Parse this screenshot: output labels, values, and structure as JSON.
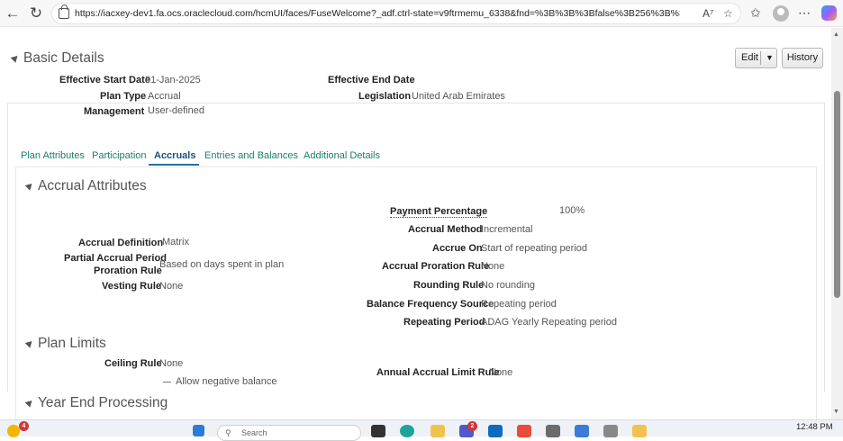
{
  "browser": {
    "url": "https://iacxey-dev1.fa.ocs.oraclecloud.com/hcmUI/faces/FuseWelcome?_adf.ctrl-state=v9ftrmemu_6338&fnd=%3B%3B%3Bfalse%3B256%3B%3B%..."
  },
  "basic_details": {
    "title": "Basic Details",
    "edit_label": "Edit",
    "history_label": "History",
    "fields": {
      "effective_start_label": "Effective Start Date",
      "effective_start_value": "01-Jan-2025",
      "effective_end_label": "Effective End Date",
      "effective_end_value": "",
      "plan_type_label": "Plan Type",
      "plan_type_value": "Accrual",
      "legislation_label": "Legislation",
      "legislation_value": "United Arab Emirates",
      "management_label": "Management",
      "management_value": "User-defined"
    }
  },
  "tabs": [
    "Plan Attributes",
    "Participation",
    "Accruals",
    "Entries and Balances",
    "Additional Details"
  ],
  "accrual_attributes": {
    "title": "Accrual Attributes",
    "payment_percentage_label": "Payment Percentage",
    "payment_percentage_value": "100%",
    "accrual_method_label": "Accrual Method",
    "accrual_method_value": "Incremental",
    "accrual_definition_label": "Accrual Definition",
    "accrual_definition_value": "Matrix",
    "accrue_on_label": "Accrue On",
    "accrue_on_value": "Start of repeating period",
    "partial_period_label_1": "Partial Accrual Period",
    "partial_period_label_2": "Proration Rule",
    "partial_period_value": "Based on days spent in plan",
    "accrual_proration_label": "Accrual Proration Rule",
    "accrual_proration_value": "None",
    "vesting_rule_label": "Vesting Rule",
    "vesting_rule_value": "None",
    "rounding_rule_label": "Rounding Rule",
    "rounding_rule_value": "No rounding",
    "balance_freq_label": "Balance Frequency Source",
    "balance_freq_value": "Repeating period",
    "repeating_period_label": "Repeating Period",
    "repeating_period_value": "ADAG Yearly Repeating period"
  },
  "plan_limits": {
    "title": "Plan Limits",
    "ceiling_rule_label": "Ceiling Rule",
    "ceiling_rule_value": "None",
    "annual_limit_label": "Annual Accrual Limit Rule",
    "annual_limit_value": "None",
    "allow_negative_label": "Allow negative balance"
  },
  "year_end": {
    "title": "Year End Processing"
  },
  "taskbar": {
    "search_placeholder": "Search",
    "time": "12:48 PM",
    "notif_count": "4",
    "teams_count": "2"
  }
}
